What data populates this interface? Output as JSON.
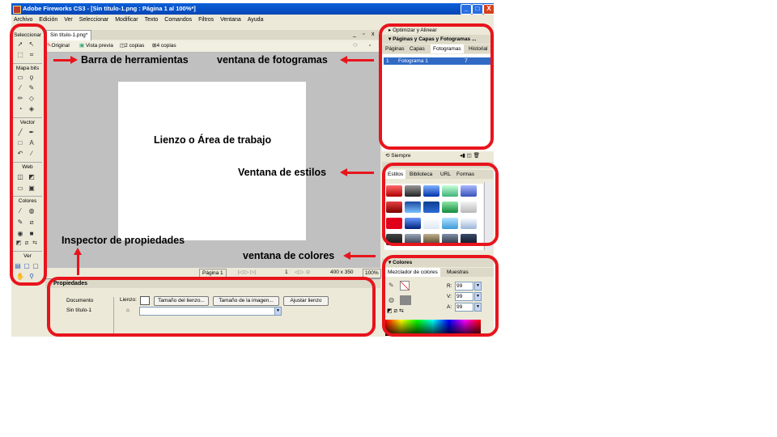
{
  "window": {
    "title": "Adobe Fireworks CS3 - [Sin título-1.png : Página 1 al 100%*]",
    "controls": {
      "minimize": "_",
      "maximize": "□",
      "close": "X"
    }
  },
  "menu": [
    "Archivo",
    "Edición",
    "Ver",
    "Seleccionar",
    "Modificar",
    "Texto",
    "Comandos",
    "Filtros",
    "Ventana",
    "Ayuda"
  ],
  "toolbox": {
    "sections": [
      "Seleccionar",
      "Mapa bits",
      "Vector",
      "Web",
      "Colores",
      "Ver"
    ]
  },
  "document": {
    "tab": "Sin título-1.png*",
    "views": [
      "Original",
      "Vista previa",
      "2 copias",
      "4 copias"
    ]
  },
  "statusbar": {
    "page": "Página 1",
    "frame": "1",
    "size": "400 x 350",
    "zoom": "100%"
  },
  "properties": {
    "title": "Propiedades",
    "doc_label": "Documento",
    "doc_name": "Sin título-1",
    "canvas_label": "Lienzo:",
    "btn_canvas_size": "Tamaño del lienzo...",
    "btn_image_size": "Tamaño de la imagen...",
    "btn_fit_canvas": "Ajustar lienzo"
  },
  "right_panel": {
    "optimize_title": "Optimizar y Alinear",
    "pages_title": "Páginas y Capas y Fotogramas ...",
    "tabs": [
      "Páginas",
      "Capas",
      "Fotogramas",
      "Historial"
    ],
    "frame_row": {
      "num": "1",
      "name": "Fotograma 1",
      "delay": "7"
    },
    "loop_label": "Siempre",
    "styles_tabs": [
      "Estilos",
      "Biblioteca",
      "URL",
      "Formas"
    ],
    "colors_title": "Colores",
    "colors_tabs": [
      "Mezclador de colores",
      "Muestras"
    ],
    "rgb": [
      {
        "label": "R:",
        "value": "99"
      },
      {
        "label": "V:",
        "value": "99"
      },
      {
        "label": "A:",
        "value": "99"
      }
    ]
  },
  "annotations": {
    "toolbar": "Barra de herramientas",
    "frames": "ventana de fotogramas",
    "canvas": "Lienzo o Área de trabajo",
    "styles": "Ventana de estilos",
    "inspector": "Inspector de propiedades",
    "colors": "ventana de colores"
  },
  "colors": {
    "highlight": "#e8141c",
    "titlebar": "#0846b5",
    "selection": "#316ac5"
  }
}
